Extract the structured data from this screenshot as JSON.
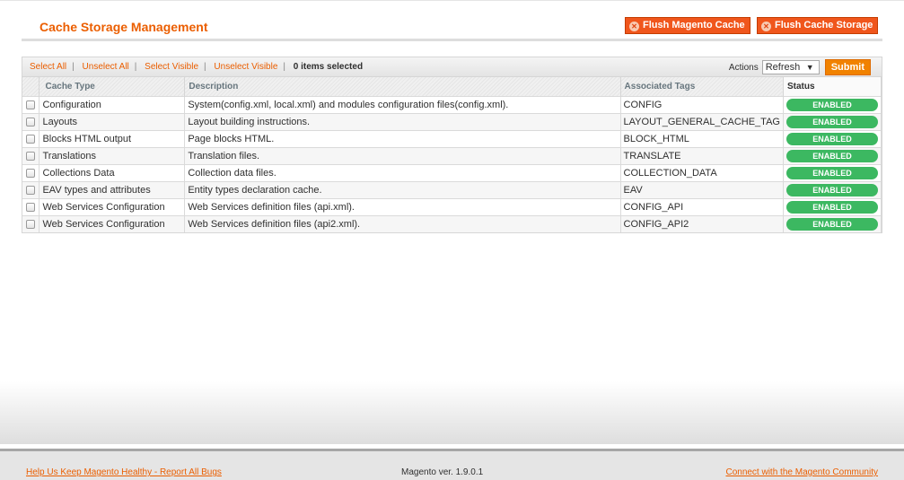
{
  "header": {
    "title": "Cache Storage Management",
    "flush_magento": "Flush Magento Cache",
    "flush_storage": "Flush Cache Storage"
  },
  "massaction": {
    "select_all": "Select All",
    "unselect_all": "Unselect All",
    "select_visible": "Select Visible",
    "unselect_visible": "Unselect Visible",
    "selected_count": "0 items selected",
    "actions_label": "Actions",
    "action_value": "Refresh",
    "submit": "Submit"
  },
  "columns": [
    "Cache Type",
    "Description",
    "Associated Tags",
    "Status"
  ],
  "rows": [
    {
      "type": "Configuration",
      "desc": "System(config.xml, local.xml) and modules configuration files(config.xml).",
      "tags": "CONFIG",
      "status": "ENABLED"
    },
    {
      "type": "Layouts",
      "desc": "Layout building instructions.",
      "tags": "LAYOUT_GENERAL_CACHE_TAG",
      "status": "ENABLED"
    },
    {
      "type": "Blocks HTML output",
      "desc": "Page blocks HTML.",
      "tags": "BLOCK_HTML",
      "status": "ENABLED"
    },
    {
      "type": "Translations",
      "desc": "Translation files.",
      "tags": "TRANSLATE",
      "status": "ENABLED"
    },
    {
      "type": "Collections Data",
      "desc": "Collection data files.",
      "tags": "COLLECTION_DATA",
      "status": "ENABLED"
    },
    {
      "type": "EAV types and attributes",
      "desc": "Entity types declaration cache.",
      "tags": "EAV",
      "status": "ENABLED"
    },
    {
      "type": "Web Services Configuration",
      "desc": "Web Services definition files (api.xml).",
      "tags": "CONFIG_API",
      "status": "ENABLED"
    },
    {
      "type": "Web Services Configuration",
      "desc": "Web Services definition files (api2.xml).",
      "tags": "CONFIG_API2",
      "status": "ENABLED"
    }
  ],
  "colors": {
    "accent": "#eb5e00",
    "enabled": "#3cb861",
    "flush_button": "#f0561c"
  },
  "footer": {
    "bugs_link": "Help Us Keep Magento Healthy - Report All Bugs",
    "version": "Magento ver. 1.9.0.1",
    "community_link": "Connect with the Magento Community"
  }
}
